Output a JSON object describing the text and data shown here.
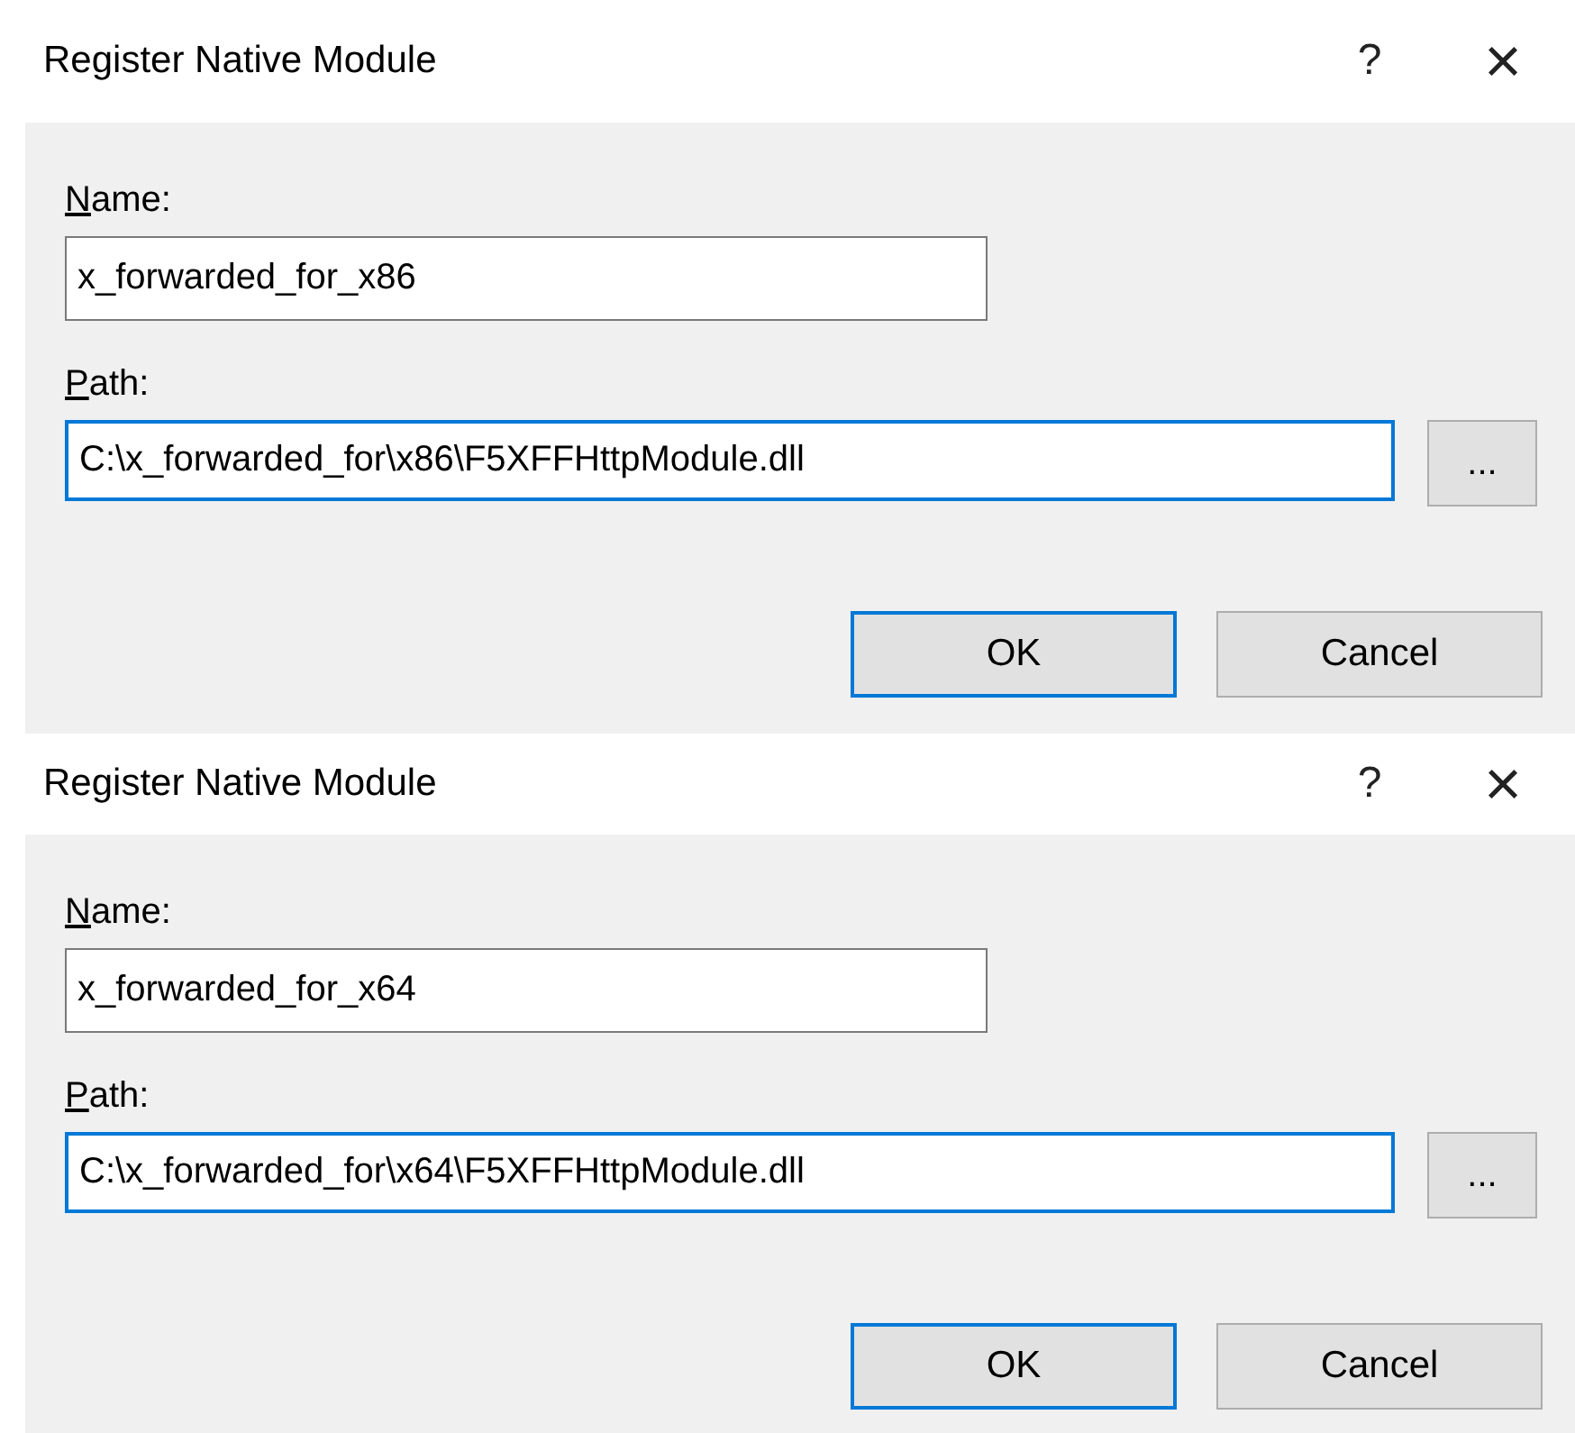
{
  "dialogs": [
    {
      "title": "Register Native Module",
      "help": "?",
      "close": "×",
      "name_label": "Name:",
      "name_value": "x_forwarded_for_x86",
      "name_focused": false,
      "path_label": "Path:",
      "path_value": "C:\\x_forwarded_for\\x86\\F5XFFHttpModule.dll",
      "path_focused": true,
      "browse": "...",
      "buttons": [
        {
          "label": "OK",
          "default": true
        },
        {
          "label": "Cancel",
          "default": false
        }
      ]
    },
    {
      "title": "Register Native Module",
      "help": "?",
      "close": "×",
      "name_label": "Name:",
      "name_value": "x_forwarded_for_x64",
      "name_focused": false,
      "path_label": "Path:",
      "path_value": "C:\\x_forwarded_for\\x64\\F5XFFHttpModule.dll",
      "path_focused": true,
      "browse": "...",
      "buttons": [
        {
          "label": "OK",
          "default": true
        },
        {
          "label": "Cancel",
          "default": false
        }
      ]
    }
  ]
}
